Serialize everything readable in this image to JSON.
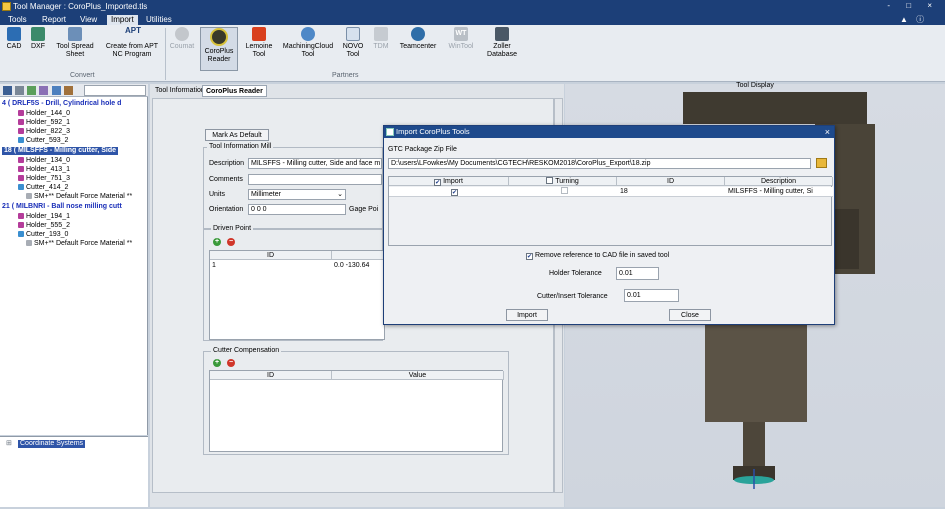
{
  "window": {
    "title": "Tool Manager : CoroPlus_Imported.tls",
    "controls": "- □ ×"
  },
  "menu": [
    "Tools",
    "Report",
    "View",
    "Import",
    "Utilities"
  ],
  "menu_right": "▲ ⓘ ▣",
  "ribbon": {
    "convert": [
      {
        "label": "CAD",
        "icon": "cad-icon"
      },
      {
        "label": "DXF",
        "icon": "dxf-icon"
      },
      {
        "label": "Tool Spread\nSheet",
        "icon": "spreadsheet-icon"
      },
      {
        "label": "Create from APT\nNC Program",
        "icon": "apt-icon",
        "icon_text": "APT"
      }
    ],
    "convert_label": "Convert",
    "partners": [
      {
        "label": "Coumat",
        "icon": "coumat-icon",
        "disabled": true
      },
      {
        "label": "CoroPlus\nReader",
        "icon": "coroplus-icon",
        "selected": true
      },
      {
        "label": "Lemoine\nTool",
        "icon": "lemoine-icon"
      },
      {
        "label": "MachiningCloud\nTool",
        "icon": "machiningcloud-icon"
      },
      {
        "label": "NOVO\nTool",
        "icon": "novo-icon"
      },
      {
        "label": "TDM",
        "icon": "tdm-icon",
        "disabled": true
      },
      {
        "label": "Teamcenter",
        "icon": "teamcenter-icon"
      },
      {
        "label": "WinTool",
        "icon": "wintool-icon",
        "disabled": true,
        "icon_text": "WT"
      },
      {
        "label": "Zoller\nDatabase",
        "icon": "zoller-icon"
      }
    ],
    "partners_label": "Partners"
  },
  "tree": [
    {
      "text": "4 ( DRLF5S - Drill, Cylindrical hole d",
      "type": "header"
    },
    {
      "text": "Holder_144_0",
      "type": "holder"
    },
    {
      "text": "Holder_592_1",
      "type": "holder"
    },
    {
      "text": "Holder_822_3",
      "type": "holder"
    },
    {
      "text": "Cutter_593_2",
      "type": "cutter"
    },
    {
      "text": "18 ( MILSFFS - Milling cutter, Side",
      "type": "selected"
    },
    {
      "text": "Holder_134_0",
      "type": "holder"
    },
    {
      "text": "Holder_413_1",
      "type": "holder"
    },
    {
      "text": "Holder_751_3",
      "type": "holder"
    },
    {
      "text": "Cutter_414_2",
      "type": "cutter"
    },
    {
      "text": "SM+** Default Force Material **",
      "type": "material"
    },
    {
      "text": "21 ( MILBNRI - Ball nose milling cutt",
      "type": "header"
    },
    {
      "text": "Holder_194_1",
      "type": "holder"
    },
    {
      "text": "Holder_555_2",
      "type": "holder"
    },
    {
      "text": "Cutter_193_0",
      "type": "cutter"
    },
    {
      "text": "SM+** Default Force Material **",
      "type": "material"
    }
  ],
  "coord_item": "Coordinate Systems",
  "tabs": [
    "Tool Information",
    "CoroPlus Reader"
  ],
  "form": {
    "mark_default": "Mark As Default",
    "tool_info_legend": "Tool Information",
    "tool_info_type": "Mill",
    "description_label": "Description",
    "description_value": "MILSFFS - Milling cutter, Side and face m",
    "comments_label": "Comments",
    "units_label": "Units",
    "units_value": "Millimeter",
    "orientation_label": "Orientation",
    "orientation_value": "0 0 0",
    "gage_label": "Gage Poi",
    "driven_legend": "Driven Point",
    "driven_cols": [
      "ID",
      ""
    ],
    "driven_rows": [
      [
        "1",
        "0.0 -130.64"
      ]
    ],
    "cutter_comp_legend": "Cutter Compensation",
    "cutter_comp_cols": [
      "ID",
      "Value"
    ]
  },
  "display_title": "Tool Display",
  "dialog": {
    "title": "Import CoroPlus Tools",
    "gtc_label": "GTC Package Zip File",
    "gtc_path": "D:\\users\\LFowkes\\My Documents\\CGTECH\\RESKOM2018\\CoroPlus_Export\\18.zip",
    "cols": [
      "Import",
      "Turning",
      "ID",
      "Description"
    ],
    "rows": [
      {
        "id": "18",
        "description": "MILSFFS - Milling cutter, Si"
      }
    ],
    "remove_ref_label": "Remove reference to CAD file in saved tool",
    "holder_tol_label": "Holder Tolerance",
    "holder_tol_value": "0.01",
    "cutter_tol_label": "Cutter/Insert Tolerance",
    "cutter_tol_value": "0.01",
    "import_btn": "Import",
    "close_btn": "Close",
    "close_icon": "×"
  },
  "colors": {
    "title_bar": "#1c3f78",
    "accent": "#2f55a8",
    "tool_body": "#5b5346",
    "tool_tip": "#2aa39a"
  }
}
